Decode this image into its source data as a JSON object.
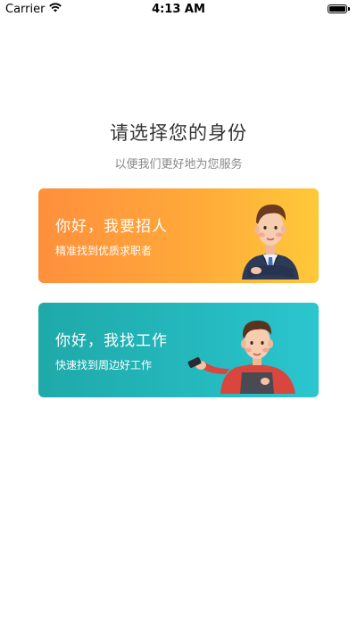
{
  "status_bar": {
    "carrier": "Carrier",
    "time": "4:13 AM",
    "battery_level": 1.0
  },
  "header": {
    "title": "请选择您的身份",
    "subtitle": "以便我们更好地为您服务"
  },
  "cards": [
    {
      "title": "你好，我要招人",
      "description": "精准找到优质求职者",
      "illustration": "businessman-in-suit",
      "colors": [
        "#ff8f3c",
        "#ffc83a"
      ]
    },
    {
      "title": "你好，我找工作",
      "description": "快速找到周边好工作",
      "illustration": "worker-with-phone",
      "colors": [
        "#1fa9a9",
        "#2bc6cf"
      ]
    }
  ],
  "icons": {
    "wifi": "wifi-icon",
    "battery": "battery-icon"
  }
}
